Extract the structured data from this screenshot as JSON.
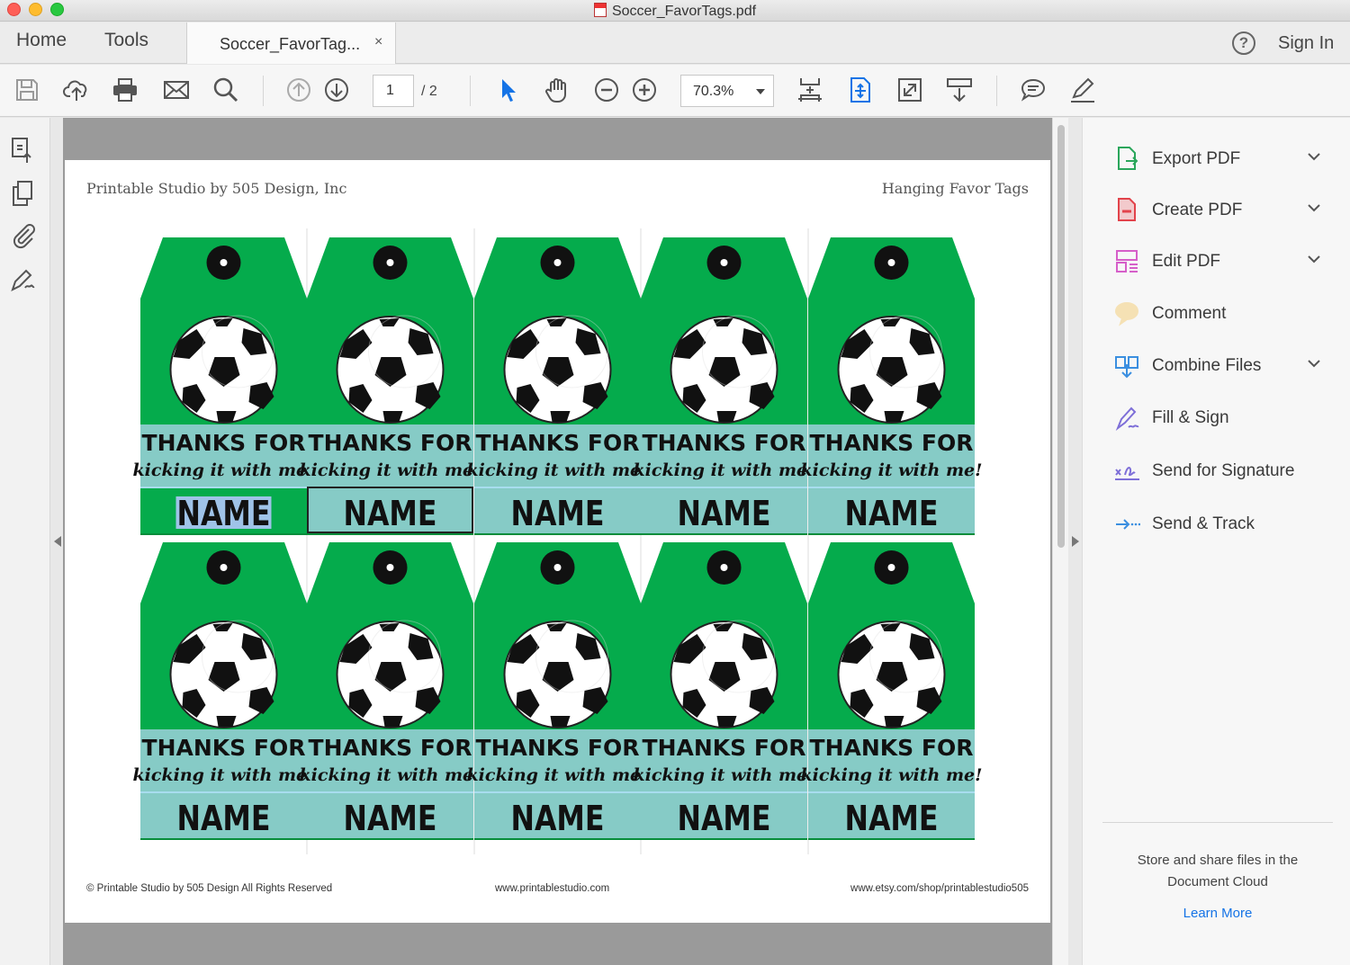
{
  "window": {
    "title": "Soccer_FavorTags.pdf"
  },
  "tabs": {
    "home": "Home",
    "tools": "Tools",
    "doc_tab": "Soccer_FavorTag...",
    "close": "×",
    "help": "?",
    "sign_in": "Sign In"
  },
  "toolbar": {
    "icons": [
      "save-icon",
      "cloud-upload-icon",
      "print-icon",
      "email-icon",
      "search-icon",
      "prev-page-icon",
      "next-page-icon",
      "select-arrow-icon",
      "hand-icon",
      "zoom-out-icon",
      "zoom-in-icon",
      "scroll-mode-icon",
      "fit-page-icon",
      "full-screen-icon",
      "read-mode-icon",
      "comment-icon",
      "highlight-pen-icon"
    ],
    "page_number": "1",
    "page_total": "/ 2",
    "zoom": "70.3%"
  },
  "left_rail": {
    "icons": [
      "page-thumbnails-icon",
      "copy-pages-icon",
      "attachment-icon",
      "signature-pen-icon"
    ]
  },
  "document": {
    "header_left": "Printable Studio by 505 Design, Inc",
    "header_right": "Hanging Favor Tags",
    "footer_left": "© Printable Studio by 505 Design All Rights Reserved",
    "footer_center": "www.printablestudio.com",
    "footer_right": "www.etsy.com/shop/printablestudio505",
    "tag": {
      "line1": "THANKS FOR",
      "line2": "kicking it with me!",
      "name": "NAME"
    },
    "rows": 2,
    "columns": 5,
    "colors": {
      "green": "#05ab4c",
      "teal": "#86cbc6",
      "dark_green": "#078d3b"
    }
  },
  "right_panel": {
    "tools": [
      {
        "label": "Export PDF",
        "icon": "export-pdf-icon",
        "chevron": true,
        "color": "#2aa65b"
      },
      {
        "label": "Create PDF",
        "icon": "create-pdf-icon",
        "chevron": true,
        "color": "#e2434b"
      },
      {
        "label": "Edit PDF",
        "icon": "edit-pdf-icon",
        "chevron": true,
        "color": "#d65fc9"
      },
      {
        "label": "Comment",
        "icon": "comment-icon",
        "chevron": false,
        "color": "#f2b01e"
      },
      {
        "label": "Combine Files",
        "icon": "combine-files-icon",
        "chevron": true,
        "color": "#3b8fe0"
      },
      {
        "label": "Fill & Sign",
        "icon": "fill-sign-icon",
        "chevron": false,
        "color": "#7e6fd8"
      },
      {
        "label": "Send for Signature",
        "icon": "send-signature-icon",
        "chevron": false,
        "color": "#7e6fd8"
      },
      {
        "label": "Send & Track",
        "icon": "send-track-icon",
        "chevron": false,
        "color": "#3b8fe0"
      }
    ],
    "promo_line1": "Store and share files in the",
    "promo_line2": "Document Cloud",
    "learn_more": "Learn More"
  }
}
